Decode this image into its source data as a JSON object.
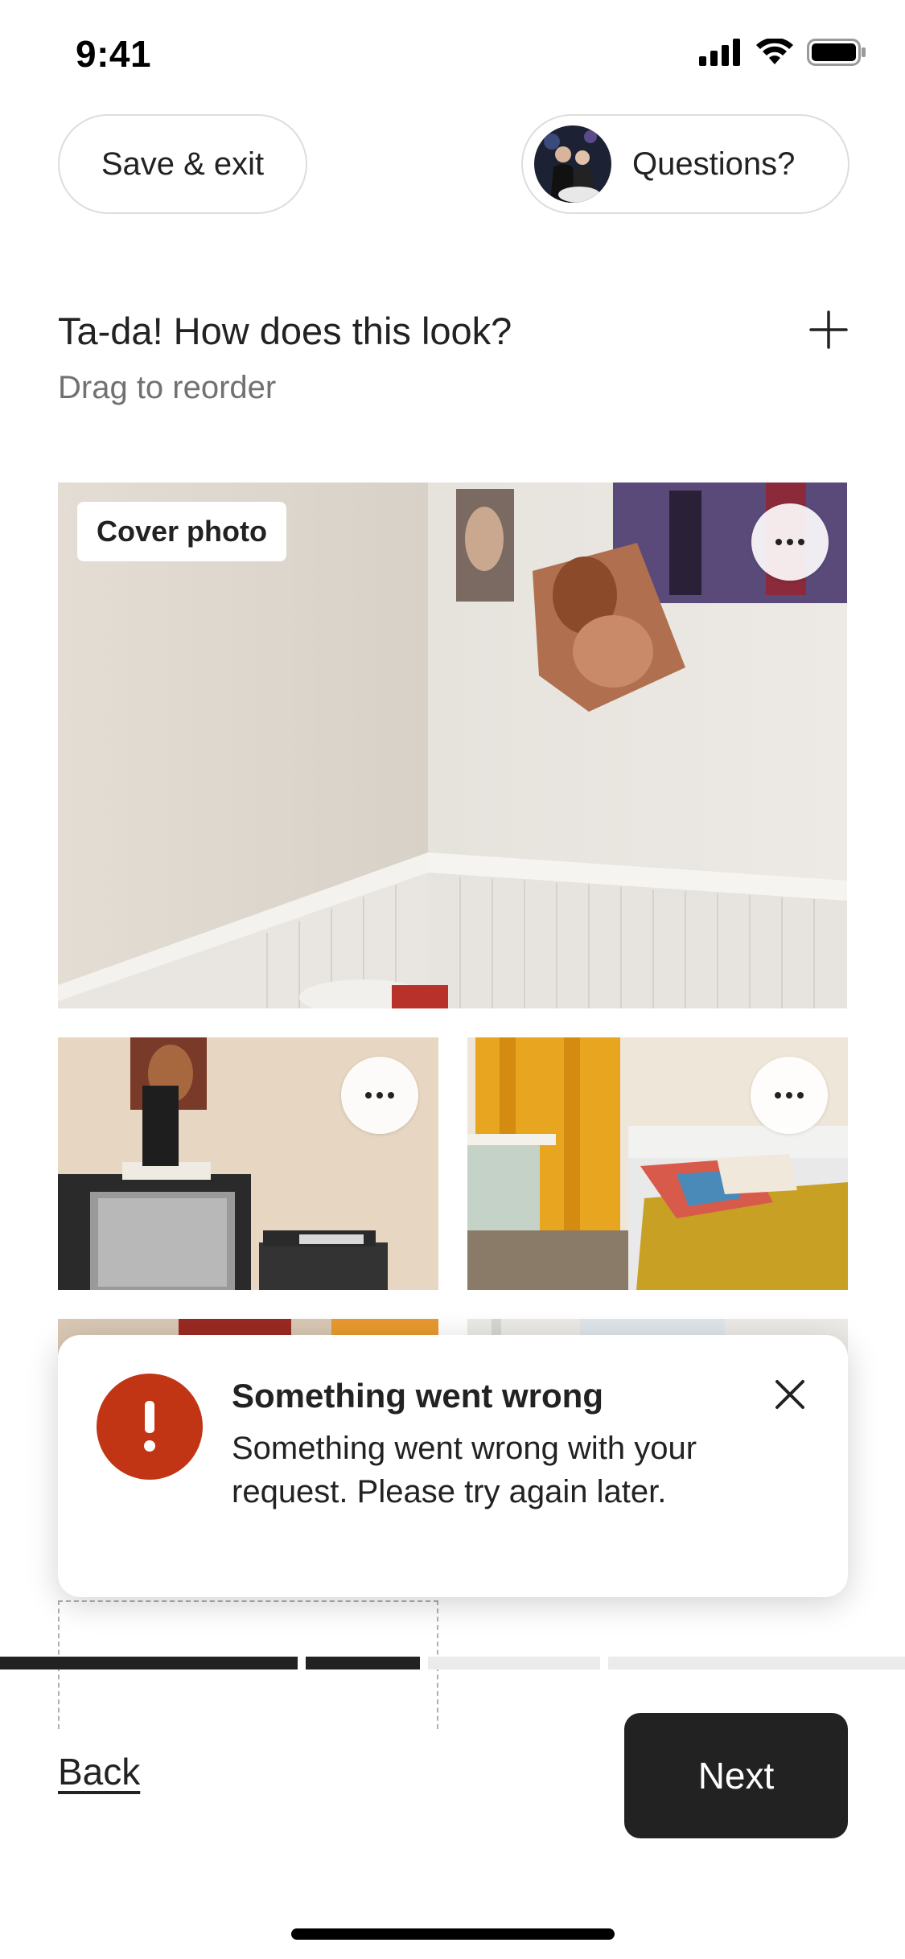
{
  "status_bar": {
    "time": "9:41"
  },
  "header": {
    "save_exit_label": "Save & exit",
    "questions_label": "Questions?",
    "title": "Ta-da! How does this look?",
    "subtitle": "Drag to reorder"
  },
  "photos": {
    "cover_badge": "Cover photo"
  },
  "toast": {
    "icon": "exclamation-icon",
    "title": "Something went wrong",
    "message": "Something went wrong with your request. Please try again later.",
    "color": "#c13515"
  },
  "progress": {
    "segments": [
      1.0,
      1.0,
      0.0,
      0.0
    ]
  },
  "footer": {
    "back_label": "Back",
    "next_label": "Next"
  },
  "colors": {
    "primary": "#222222",
    "muted": "#717171",
    "error": "#c13515"
  }
}
